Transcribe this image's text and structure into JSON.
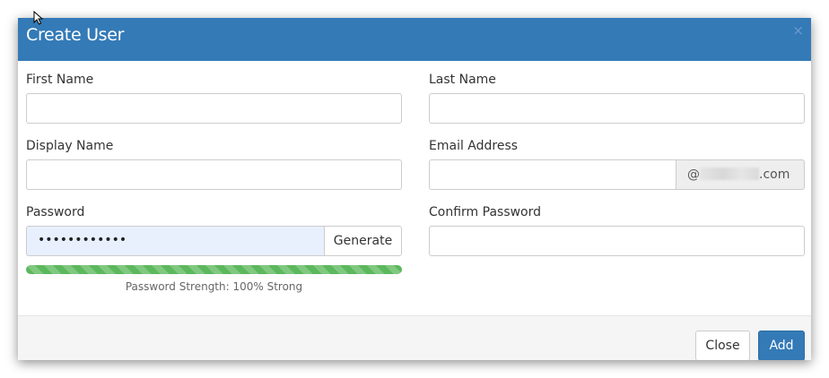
{
  "dialog": {
    "title": "Create User",
    "close_glyph": "×"
  },
  "form": {
    "first_name": {
      "label": "First Name",
      "value": "",
      "placeholder": ""
    },
    "last_name": {
      "label": "Last Name",
      "value": "",
      "placeholder": ""
    },
    "display_name": {
      "label": "Display Name",
      "value": "",
      "placeholder": ""
    },
    "email": {
      "label": "Email Address",
      "value": "",
      "placeholder": "",
      "domain_prefix": "@",
      "domain_suffix": ".com"
    },
    "password": {
      "label": "Password",
      "masked_value": "••••••••••••",
      "generate_label": "Generate",
      "strength_text": "Password Strength: 100% Strong",
      "strength_percent": 100
    },
    "confirm_password": {
      "label": "Confirm Password",
      "value": "",
      "placeholder": ""
    }
  },
  "footer": {
    "close_label": "Close",
    "add_label": "Add"
  },
  "colors": {
    "header": "#337ab7",
    "primary": "#337ab7",
    "success": "#5cb85c",
    "autofill": "#e8f0fe"
  },
  "icons": {
    "cursor": "mouse-pointer-icon",
    "close": "close-icon"
  }
}
